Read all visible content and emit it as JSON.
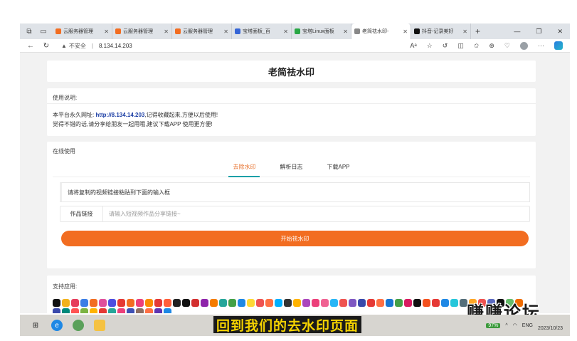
{
  "browser": {
    "tabs": [
      {
        "label": "云服务器管理",
        "color": "#f26d21",
        "active": false
      },
      {
        "label": "云服务器管理",
        "color": "#f26d21",
        "active": false
      },
      {
        "label": "云服务器管理",
        "color": "#f26d21",
        "active": false
      },
      {
        "label": "宝塔面板_百",
        "color": "#3565d6",
        "active": false
      },
      {
        "label": "宝塔Linux面板",
        "color": "#29a745",
        "active": false
      },
      {
        "label": "老简祛水印-",
        "color": "#888888",
        "active": true
      },
      {
        "label": "抖音-记录美好",
        "color": "#111111",
        "active": false
      }
    ],
    "new_tab": "+",
    "address": {
      "insecure_label": "不安全",
      "url": "8.134.14.203"
    }
  },
  "page": {
    "title": "老简祛水印",
    "usage": {
      "heading": "使用说明:",
      "line1_prefix": "本平台永久网址: ",
      "line1_link": "http://8.134.14.203",
      "line1_suffix": ",记得收藏起来,方便以后使用!",
      "line2": "觉得不错的话,请分享给朋友一起用哦,建议下载APP 使用更方便!"
    },
    "online": {
      "heading": "在线使用",
      "tabs": [
        {
          "label": "去除水印",
          "active": true
        },
        {
          "label": "解析日志",
          "active": false
        },
        {
          "label": "下载APP",
          "active": false
        }
      ],
      "notice": "请将复制的视频链接粘贴到下面的输入框",
      "input_label": "作品链接",
      "input_placeholder": "请输入短视频作品分享链接~",
      "input_value": "",
      "start_button": "开始祛水印"
    },
    "support": {
      "heading": "支持应用:",
      "app_colors": [
        "#111111",
        "#f2b21d",
        "#e63d5c",
        "#3b7ee6",
        "#f26d21",
        "#e04f9c",
        "#4e4ee0",
        "#e53935",
        "#f26d21",
        "#ec407a",
        "#fb8c00",
        "#e53935",
        "#ff5e3a",
        "#222222",
        "#111111",
        "#d32f2f",
        "#8e24aa",
        "#f57c00",
        "#26a69a",
        "#43a047",
        "#1e88e5",
        "#fdd835",
        "#ef5350",
        "#ff7043",
        "#00b0ff",
        "#333333",
        "#ffb300",
        "#ab47bc",
        "#ec407a",
        "#f06292",
        "#29b6f6",
        "#ef5350",
        "#7e57c2",
        "#3949ab",
        "#e53935",
        "#ff7043",
        "#1976d2",
        "#43a047",
        "#d81b60",
        "#111111",
        "#f4511e",
        "#e53935",
        "#1e88e5",
        "#26c6da",
        "#546e7a",
        "#ffa726",
        "#ef5350",
        "#5c6bc0",
        "#111111",
        "#66bb6a",
        "#ef6c00",
        "#3949ab",
        "#00897b",
        "#ff5252",
        "#7cb342",
        "#ffb300",
        "#e53935",
        "#26a69a",
        "#ec407a",
        "#3f51b5",
        "#8d6e63",
        "#ff7043",
        "#5e35b1",
        "#1e88e5"
      ]
    }
  },
  "overlay": {
    "watermark": "赚赚论坛",
    "subtitle": "回到我们的去水印页面"
  },
  "taskbar": {
    "battery": "97%",
    "lang": "ENG",
    "date": "2023/10/23"
  }
}
